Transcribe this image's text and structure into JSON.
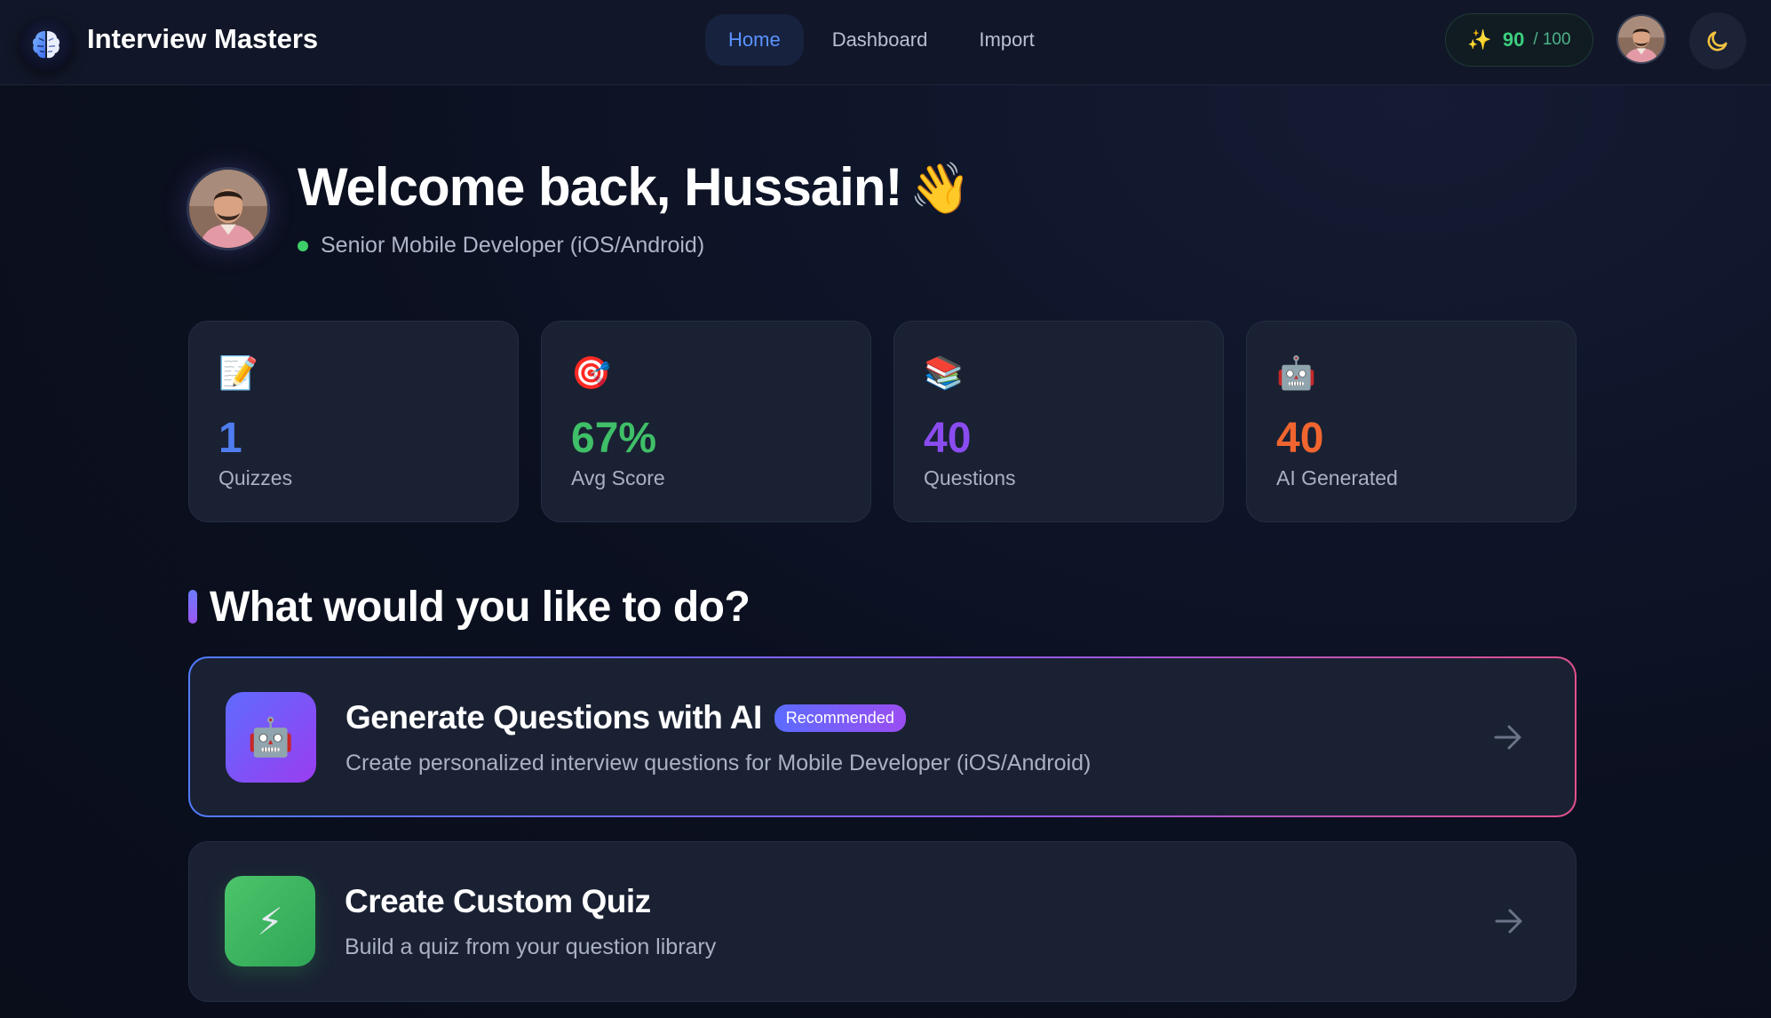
{
  "header": {
    "app_title": "Interview Masters",
    "logo_icon": "brain-icon",
    "nav": [
      {
        "label": "Home",
        "active": true
      },
      {
        "label": "Dashboard",
        "active": false
      },
      {
        "label": "Import",
        "active": false
      }
    ],
    "score": {
      "icon": "sparkles-icon",
      "value": "90",
      "max": "/ 100"
    },
    "theme_icon": "moon-icon"
  },
  "welcome": {
    "title": "Welcome back, Hussain!",
    "wave": "👋",
    "role": "Senior Mobile Developer (iOS/Android)",
    "status_color": "#3fcf6a"
  },
  "stats": [
    {
      "icon": "📝",
      "value": "1",
      "label": "Quizzes",
      "color": "#4f7df0"
    },
    {
      "icon": "🎯",
      "value": "67%",
      "label": "Avg Score",
      "color": "#3fbf68"
    },
    {
      "icon": "📚",
      "value": "40",
      "label": "Questions",
      "color": "#8a4cf0"
    },
    {
      "icon": "🤖",
      "value": "40",
      "label": "AI Generated",
      "color": "#f0652f"
    }
  ],
  "section": {
    "title": "What would you like to do?"
  },
  "actions": {
    "ai": {
      "icon": "🤖",
      "title": "Generate Questions with AI",
      "badge": "Recommended",
      "description": "Create personalized interview questions for Mobile Developer (iOS/Android)"
    },
    "quiz": {
      "icon": "⚡",
      "title": "Create Custom Quiz",
      "description": "Build a quiz from your question library"
    }
  }
}
